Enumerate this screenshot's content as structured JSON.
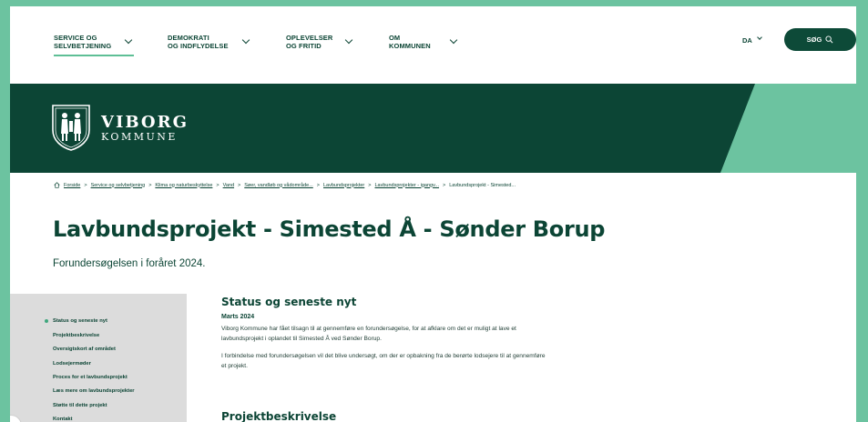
{
  "nav": {
    "items": [
      {
        "line1": "SERVICE OG",
        "line2": "SELVBETJENING"
      },
      {
        "line1": "DEMOKRATI",
        "line2": "OG INDFLYDELSE"
      },
      {
        "line1": "OPLEVELSER",
        "line2": "OG FRITID"
      },
      {
        "line1": "OM",
        "line2": "KOMMUNEN"
      }
    ],
    "language": "DA",
    "search_label": "SØG"
  },
  "logo": {
    "line1": "VIBORG",
    "line2": "KOMMUNE"
  },
  "breadcrumb": [
    "Forside",
    "Service og selvbetjening",
    "Klima og naturbeskyttelse",
    "Vand",
    "Søer, vandløb og vådområde...",
    "Lavbundsprojekter",
    "Lavbundsprojekter - igangv...",
    "Lavbundsprojekt - Simested..."
  ],
  "page": {
    "title": "Lavbundsprojekt - Simested Å - Sønder Borup",
    "subtitle": "Forundersøgelsen i foråret 2024."
  },
  "sidemenu": {
    "items": [
      "Status og seneste nyt",
      "Projektbeskrivelse",
      "Oversigtskort af området",
      "Lodsejermøder",
      "Proces for et lavbundsprojekt",
      "Læs mere om lavbundsprojekter",
      "Støtte til dette projekt",
      "Kontakt"
    ],
    "active_index": 0
  },
  "content": {
    "section1_title": "Status og seneste nyt",
    "date": "Marts 2024",
    "para1_line1": "Viborg Kommune har fået tilsagn til at gennemføre en forundersøgelse, for at afklare om det er muligt at lave et",
    "para1_line2": "lavbundsprojekt i oplandet til Simested Å ved Sønder Borup.",
    "para2_line1": "I forbindelse med forundersøgelsen vil det blive undersøgt, om der er opbakning fra de berørte lodsejere til at gennemføre",
    "para2_line2": "et projekt.",
    "section2_title": "Projektbeskrivelse"
  },
  "colors": {
    "brand_dark": "#0c4535",
    "brand_light": "#6cc3a0",
    "sidemenu_bg": "#dcdcdc"
  }
}
